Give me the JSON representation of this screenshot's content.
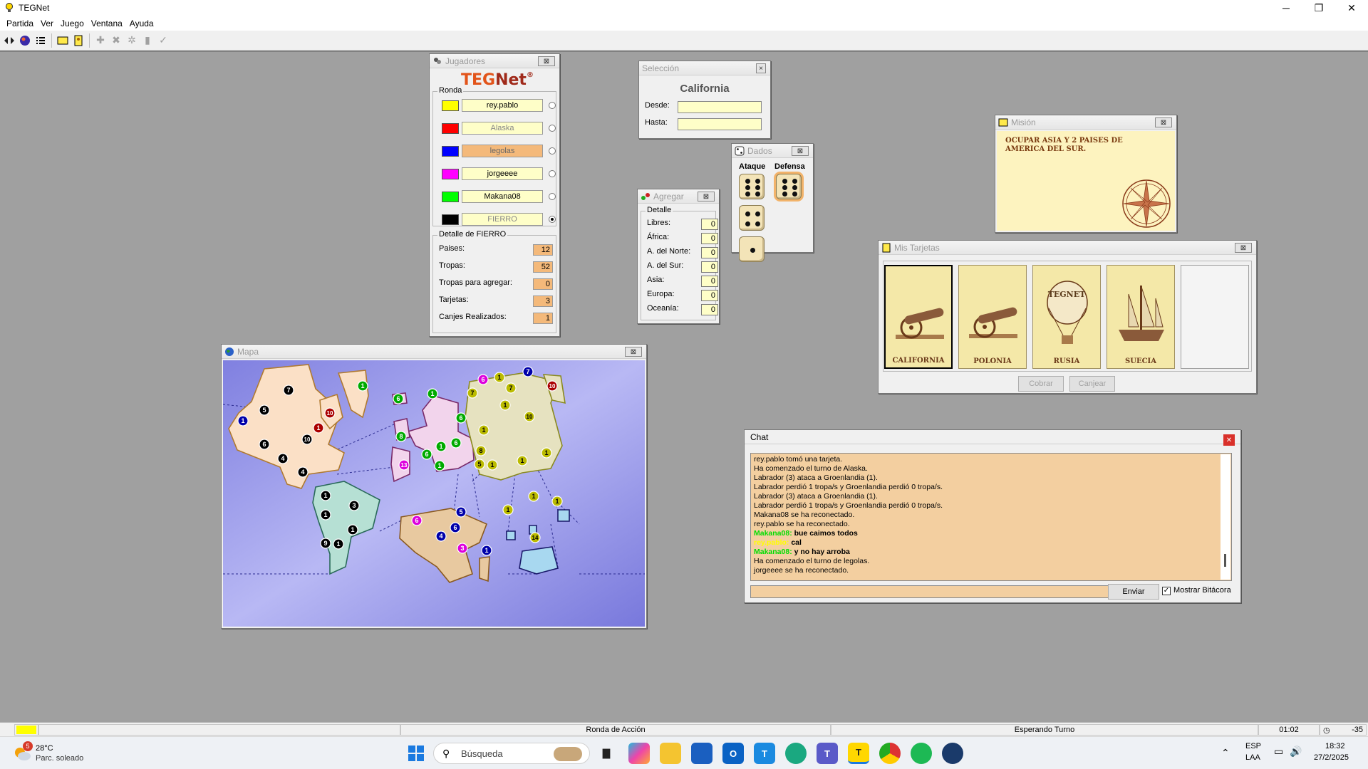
{
  "app": {
    "title": "TEGNet"
  },
  "window_controls": {
    "minimize": "─",
    "restore": "❐",
    "close": "✕"
  },
  "menu": [
    "Partida",
    "Ver",
    "Juego",
    "Ventana",
    "Ayuda"
  ],
  "toolbar": {
    "icons": [
      "connect-icon",
      "globe-icon",
      "list-icon",
      "yellow-card-icon",
      "mission-icon",
      "add-icon",
      "cancel-icon",
      "gear-icon",
      "card-icon",
      "check-icon"
    ]
  },
  "jugadores": {
    "title": "Jugadores",
    "logo_a": "TEG",
    "logo_b": "Net",
    "logo_reg": "®",
    "ronda_label": "Ronda",
    "players": [
      {
        "name": "rey.pablo",
        "color": "#ffff00",
        "style": "normal",
        "radio": false
      },
      {
        "name": "Alaska",
        "color": "#ff0000",
        "style": "grey",
        "radio": false
      },
      {
        "name": "legolas",
        "color": "#0000ff",
        "style": "hl",
        "radio": false
      },
      {
        "name": "jorgeeee",
        "color": "#ff00ff",
        "style": "normal",
        "radio": false
      },
      {
        "name": "Makana08",
        "color": "#00ff00",
        "style": "normal",
        "radio": false
      },
      {
        "name": "FIERRO",
        "color": "#000000",
        "style": "grey",
        "radio": true
      }
    ],
    "detail_label": "Detalle de FIERRO",
    "details": [
      {
        "label": "Paises:",
        "value": "12"
      },
      {
        "label": "Tropas:",
        "value": "52"
      },
      {
        "label": "Tropas para agregar:",
        "value": "0"
      },
      {
        "label": "Tarjetas:",
        "value": "3"
      },
      {
        "label": "Canjes Realizados:",
        "value": "1"
      }
    ]
  },
  "seleccion": {
    "title": "Selección",
    "country": "California",
    "desde_label": "Desde:",
    "hasta_label": "Hasta:",
    "desde": "",
    "hasta": ""
  },
  "dados": {
    "title": "Dados",
    "ataque_label": "Ataque",
    "defensa_label": "Defensa",
    "ataque": [
      6,
      4,
      1
    ],
    "defensa": [
      6
    ]
  },
  "agregar": {
    "title": "Agregar",
    "detalle_label": "Detalle",
    "rows": [
      {
        "label": "Libres:",
        "value": "0"
      },
      {
        "label": "África:",
        "value": "0"
      },
      {
        "label": "A. del Norte:",
        "value": "0"
      },
      {
        "label": "A. del Sur:",
        "value": "0"
      },
      {
        "label": "Asia:",
        "value": "0"
      },
      {
        "label": "Europa:",
        "value": "0"
      },
      {
        "label": "Oceanía:",
        "value": "0"
      }
    ]
  },
  "mision": {
    "title": "Misión",
    "text": "OCUPAR ASIA Y 2 PAISES DE AMERICA DEL SUR."
  },
  "tarjetas": {
    "title": "Mis Tarjetas",
    "cards": [
      {
        "name": "CALIFORNIA",
        "type": "cannon-icon"
      },
      {
        "name": "POLONIA",
        "type": "cannon-icon"
      },
      {
        "name": "RUSIA",
        "type": "balloon-icon",
        "badge": "TEGNET"
      },
      {
        "name": "SUECIA",
        "type": "ship-icon"
      }
    ],
    "cobrar": "Cobrar",
    "canjear": "Canjear"
  },
  "mapa": {
    "title": "Mapa",
    "markers": [
      {
        "v": "7",
        "c": "#000000"
      },
      {
        "v": "5",
        "c": "#000000"
      },
      {
        "v": "1",
        "c": "#0000aa"
      },
      {
        "v": "10",
        "c": "#aa0000"
      },
      {
        "v": "1",
        "c": "#aa0000"
      },
      {
        "v": "6",
        "c": "#000000"
      },
      {
        "v": "10",
        "c": "#000000"
      },
      {
        "v": "4",
        "c": "#000000"
      },
      {
        "v": "4",
        "c": "#000000"
      },
      {
        "v": "1",
        "c": "#00aa00"
      },
      {
        "v": "6",
        "c": "#00aa00"
      },
      {
        "v": "1",
        "c": "#00aa00"
      },
      {
        "v": "6",
        "c": "#00aa00"
      },
      {
        "v": "8",
        "c": "#00aa00"
      },
      {
        "v": "6",
        "c": "#00aa00"
      },
      {
        "v": "1",
        "c": "#00aa00"
      },
      {
        "v": "6",
        "c": "#00aa00"
      },
      {
        "v": "13",
        "c": "#dd00dd"
      },
      {
        "v": "1",
        "c": "#00aa00"
      },
      {
        "v": "6",
        "c": "#dd00dd"
      },
      {
        "v": "1",
        "c": "#bbbb00"
      },
      {
        "v": "7",
        "c": "#0000aa"
      },
      {
        "v": "10",
        "c": "#aa0000"
      },
      {
        "v": "7",
        "c": "#bbbb00"
      },
      {
        "v": "7",
        "c": "#bbbb00"
      },
      {
        "v": "1",
        "c": "#bbbb00"
      },
      {
        "v": "10",
        "c": "#bbbb00"
      },
      {
        "v": "1",
        "c": "#bbbb00"
      },
      {
        "v": "8",
        "c": "#bbbb00"
      },
      {
        "v": "5",
        "c": "#bbbb00"
      },
      {
        "v": "1",
        "c": "#bbbb00"
      },
      {
        "v": "1",
        "c": "#bbbb00"
      },
      {
        "v": "1",
        "c": "#bbbb00"
      },
      {
        "v": "1",
        "c": "#000000"
      },
      {
        "v": "3",
        "c": "#000000"
      },
      {
        "v": "1",
        "c": "#000000"
      },
      {
        "v": "1",
        "c": "#000000"
      },
      {
        "v": "9",
        "c": "#000000"
      },
      {
        "v": "1",
        "c": "#000000"
      },
      {
        "v": "6",
        "c": "#dd00dd"
      },
      {
        "v": "5",
        "c": "#0000aa"
      },
      {
        "v": "6",
        "c": "#0000aa"
      },
      {
        "v": "4",
        "c": "#0000aa"
      },
      {
        "v": "3",
        "c": "#dd00dd"
      },
      {
        "v": "1",
        "c": "#0000aa"
      },
      {
        "v": "1",
        "c": "#bbbb00"
      },
      {
        "v": "1",
        "c": "#bbbb00"
      },
      {
        "v": "1",
        "c": "#bbbb00"
      },
      {
        "v": "14",
        "c": "#bbbb00"
      }
    ]
  },
  "chat": {
    "title": "Chat",
    "messages": [
      {
        "text": "rey.pablo tomó una tarjeta."
      },
      {
        "text": "Ha comenzado el turno de Alaska."
      },
      {
        "text": "Labrador (3) ataca a Groenlandia (1)."
      },
      {
        "text": "Labrador perdió 1 tropa/s y Groenlandia perdió 0 tropa/s."
      },
      {
        "text": "Labrador (3) ataca a Groenlandia (1)."
      },
      {
        "text": "Labrador perdió 1 tropa/s y Groenlandia perdió 0 tropa/s."
      },
      {
        "text": "Makana08 se ha reconectado."
      },
      {
        "text": "rey.pablo se ha reconectado."
      },
      {
        "nick": "Makana08:",
        "nick_color": "#00dd00",
        "text": "bue caimos todos"
      },
      {
        "nick": "rey.pablo:",
        "nick_color": "#ffff00",
        "text": "cal"
      },
      {
        "nick": "Makana08:",
        "nick_color": "#00dd00",
        "text": "y no hay arroba"
      },
      {
        "text": "Ha comenzado el turno de legolas."
      },
      {
        "text": "jorgeeee se ha reconectado."
      }
    ],
    "input": "",
    "send": "Enviar",
    "show_log": "Mostrar Bitácora"
  },
  "status": {
    "round": "Ronda de Acción",
    "state": "Esperando Turno",
    "time": "01:02",
    "counter": "-35",
    "color": "#ffff00"
  },
  "taskbar": {
    "weather_temp": "28°C",
    "weather_desc": "Parc. soleado",
    "weather_badge": "5",
    "search_placeholder": "Búsqueda",
    "lang1": "ESP",
    "lang2": "LAA",
    "time": "18:32",
    "date": "27/2/2025"
  }
}
